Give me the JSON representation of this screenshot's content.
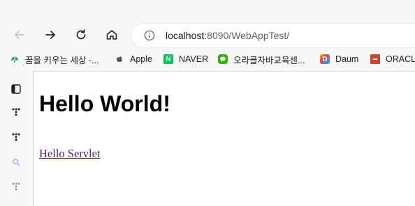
{
  "toolbar": {
    "back_icon": "arrow-left-icon",
    "forward_icon": "arrow-right-icon",
    "reload_icon": "reload-icon",
    "home_icon": "home-icon"
  },
  "address_bar": {
    "host": "localhost",
    "path": ":8090/WebAppTest/"
  },
  "bookmarks": [
    {
      "label": "꿈을 키우는 세상 -...",
      "icon": "leaf-icon",
      "color": "#3aa655"
    },
    {
      "label": "Apple",
      "icon": "apple-icon",
      "color": "#555555"
    },
    {
      "label": "NAVER",
      "icon": "naver-icon",
      "color": "#03c75a"
    },
    {
      "label": "오라클자바교육센...",
      "icon": "chat-icon",
      "color": "#2db400"
    },
    {
      "label": "Daum",
      "icon": "daum-icon",
      "color": "#f4b400"
    },
    {
      "label": "ORACLE",
      "icon": "oracle-icon",
      "color": "#c74634"
    }
  ],
  "page": {
    "heading": "Hello World!",
    "link": "Hello Servlet"
  },
  "colors": {
    "link_visited": "#551a8b",
    "chrome_bg": "#f7f7f7"
  }
}
